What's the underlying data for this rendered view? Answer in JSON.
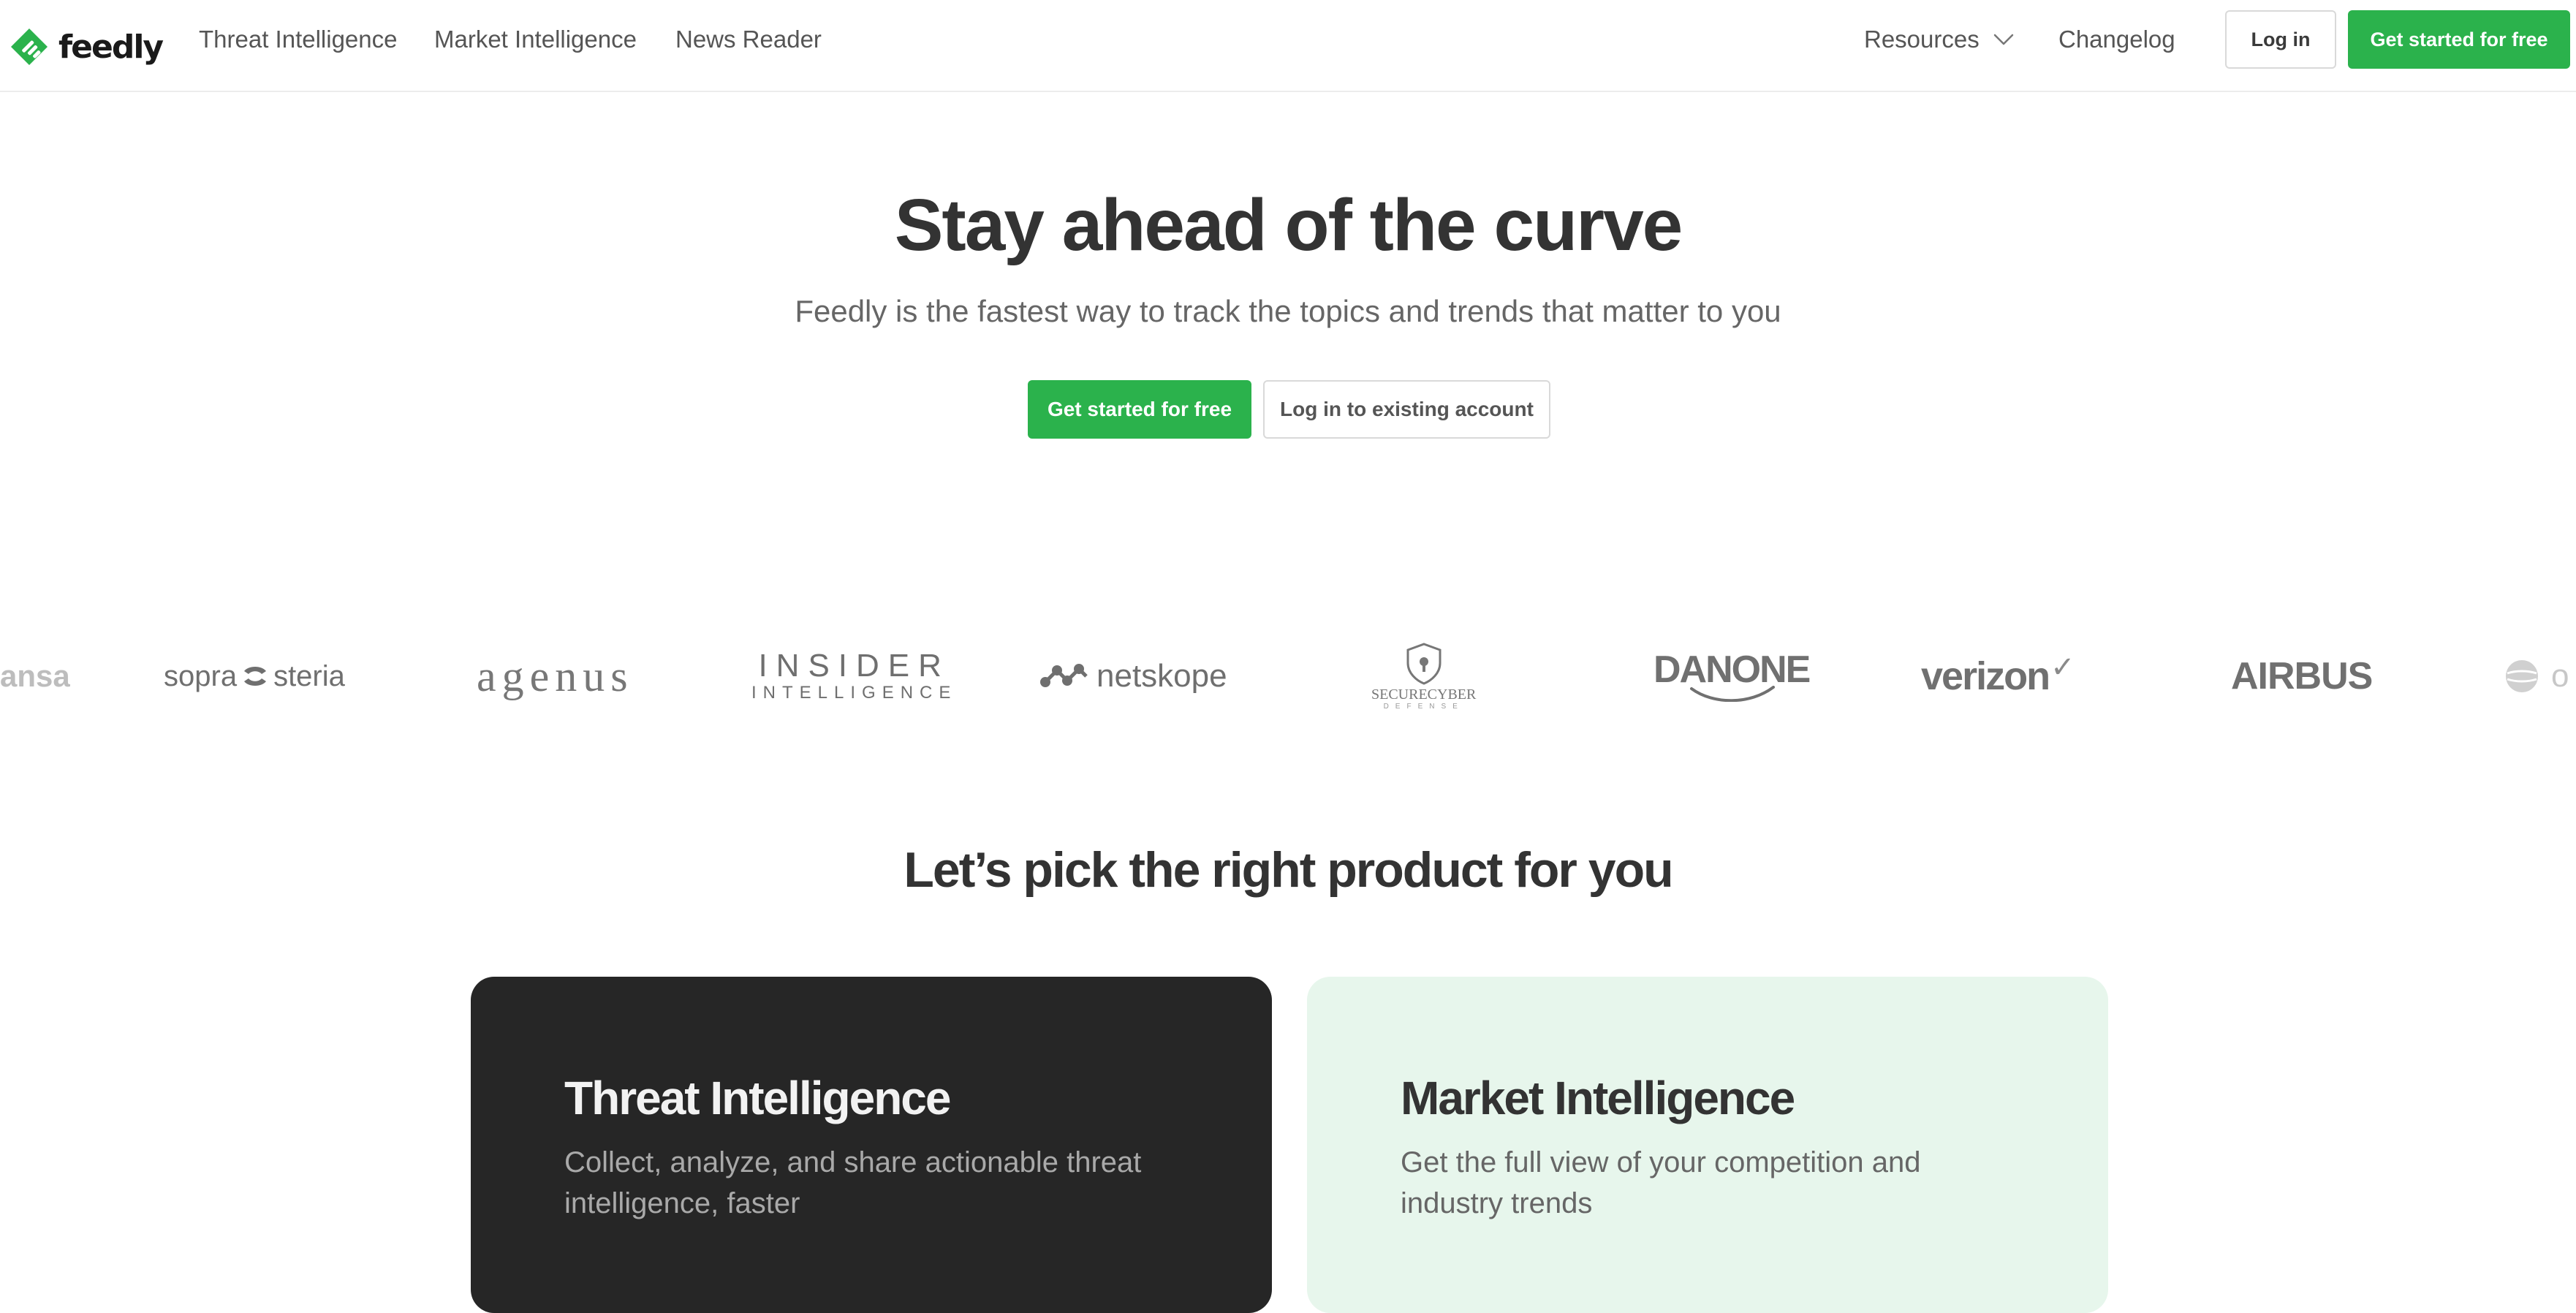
{
  "brand": {
    "name": "feedly",
    "accent": "#2bb24c"
  },
  "nav": {
    "links": [
      "Threat Intelligence",
      "Market Intelligence",
      "News Reader"
    ],
    "resources_label": "Resources",
    "changelog_label": "Changelog",
    "login_label": "Log in",
    "cta_label": "Get started for free"
  },
  "hero": {
    "title": "Stay ahead of the curve",
    "subtitle": "Feedly is the fastest way to track the topics and trends that matter to you",
    "primary_button": "Get started for free",
    "secondary_button": "Log in to existing account"
  },
  "customer_logos": {
    "partial_left": "ansa",
    "sopra_left": "sopra",
    "sopra_right": "steria",
    "agenus": "agenus",
    "insider_line1": "INSIDER",
    "insider_line2": "INTELLIGENCE",
    "netskope": "netskope",
    "securecyber_line1": "SECURECYBER",
    "securecyber_line2": "DEFENSE",
    "danone": "DANONE",
    "verizon": "verizon",
    "verizon_mark": "✓",
    "airbus": "AIRBUS",
    "partial_right": "o"
  },
  "products": {
    "heading": "Let’s pick the right product for you",
    "cards": [
      {
        "title": "Threat Intelligence",
        "description": "Collect, analyze, and share actionable threat intelligence, faster"
      },
      {
        "title": "Market Intelligence",
        "description": "Get the full view of your competition and industry trends"
      }
    ]
  }
}
